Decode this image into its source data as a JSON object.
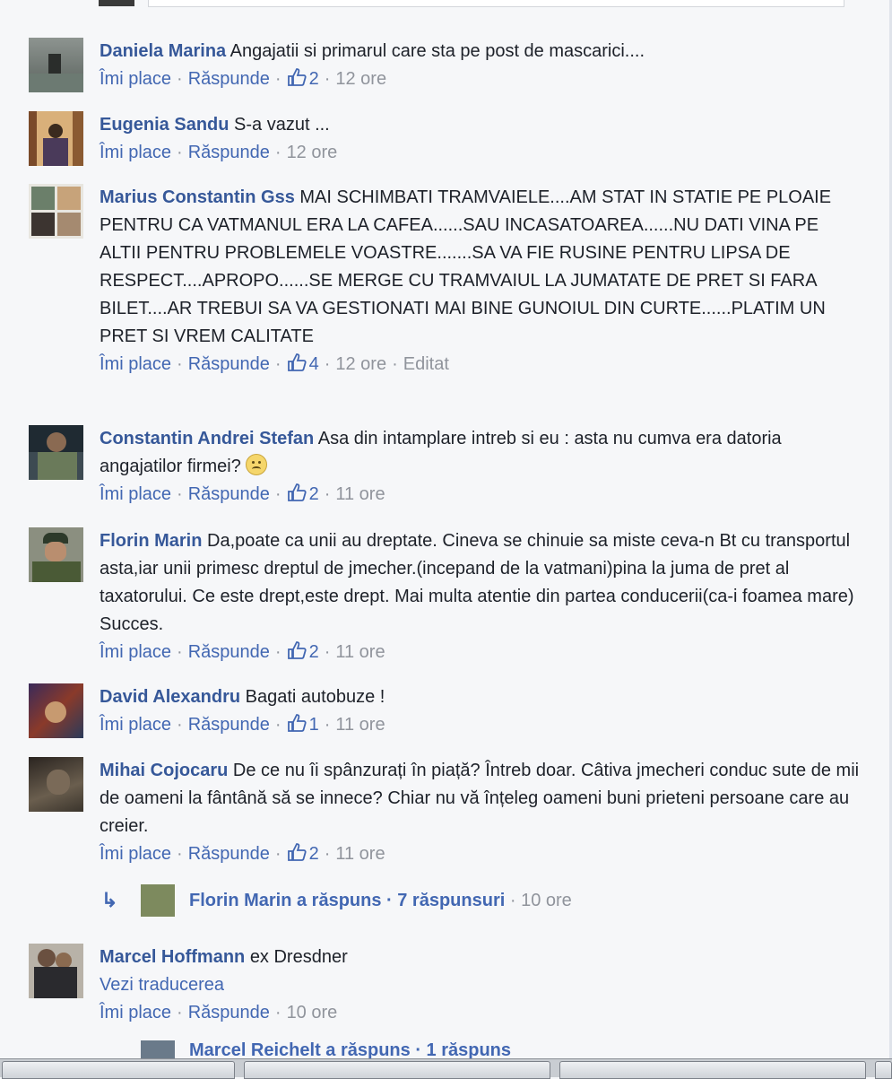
{
  "comments": [
    {
      "name": "Daniela Marina",
      "text": "Angajatii si primarul care sta pe post de mascarici....",
      "like_label": "Îmi place",
      "reply_label": "Răspunde",
      "likes": "2",
      "time": "12 ore"
    },
    {
      "name": "Eugenia Sandu",
      "text": "S-a vazut ...",
      "like_label": "Îmi place",
      "reply_label": "Răspunde",
      "time": "12 ore"
    },
    {
      "name": "Marius Constantin Gss",
      "text": "MAI SCHIMBATI TRAMVAIELE....AM STAT IN STATIE PE PLOAIE PENTRU CA VATMANUL ERA LA CAFEA......SAU INCASATOAREA......NU DATI VINA PE ALTII PENTRU PROBLEMELE VOASTRE.......SA VA FIE RUSINE PENTRU LIPSA DE RESPECT....APROPO......SE MERGE CU TRAMVAIUL LA JUMATATE DE PRET SI FARA BILET....AR TREBUI SA VA GESTIONATI MAI BINE GUNOIUL DIN CURTE......PLATIM UN PRET SI VREM CALITATE",
      "like_label": "Îmi place",
      "reply_label": "Răspunde",
      "likes": "4",
      "time": "12 ore",
      "edited": "Editat"
    },
    {
      "name": "Constantin Andrei Stefan",
      "text": "Asa din intamplare intreb si eu : asta nu cumva era datoria angajatilor firmei?",
      "like_label": "Îmi place",
      "reply_label": "Răspunde",
      "likes": "2",
      "time": "11 ore"
    },
    {
      "name": "Florin Marin",
      "text": "Da,poate ca unii au dreptate. Cineva se chinuie sa miste ceva-n Bt cu transportul asta,iar unii primesc dreptul de jmecher.(incepand de la vatmani)pina la juma de pret al taxatorului. Ce este drept,este drept. Mai multa atentie din partea conducerii(ca-i foamea mare) Succes.",
      "like_label": "Îmi place",
      "reply_label": "Răspunde",
      "likes": "2",
      "time": "11 ore"
    },
    {
      "name": "David Alexandru",
      "text": "Bagati autobuze !",
      "like_label": "Îmi place",
      "reply_label": "Răspunde",
      "likes": "1",
      "time": "11 ore"
    },
    {
      "name": "Mihai Cojocaru",
      "text": "De ce nu îi spânzurați în piață? Întreb doar. Câtiva jmecheri conduc sute de mii de oameni la fântână să se innece? Chiar nu vă înțeleg oameni buni prieteni persoane care au creier.",
      "like_label": "Îmi place",
      "reply_label": "Răspunde",
      "likes": "2",
      "time": "11 ore"
    },
    {
      "name": "Marcel Hoffmann",
      "text": "ex Dresdner",
      "translate": "Vezi traducerea",
      "like_label": "Îmi place",
      "reply_label": "Răspunde",
      "time": "10 ore"
    }
  ],
  "reply_thread": {
    "text": "Florin Marin a răspuns · 7 răspunsuri",
    "time": "10 ore"
  },
  "partial_reply": {
    "text": "Marcel Reichelt a răspuns · 1 răspuns"
  },
  "colors": {
    "name": "#365899",
    "link": "#4267b2",
    "meta": "#90949c",
    "text": "#1d2129",
    "background": "#f6f7f9"
  }
}
